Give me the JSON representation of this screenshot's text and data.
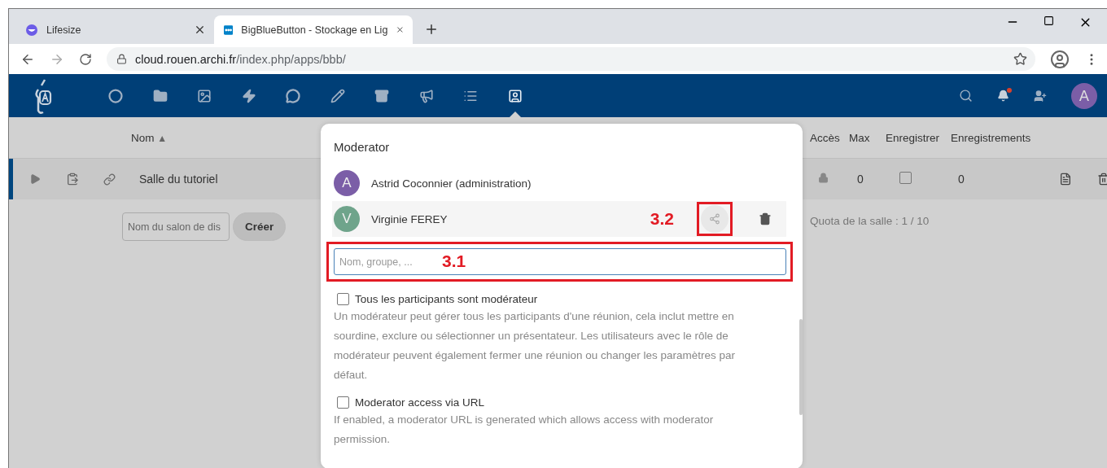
{
  "browser": {
    "tabs": [
      {
        "title": "Lifesize",
        "kind": "lifesize",
        "selected": false
      },
      {
        "title": "BigBlueButton - Stockage en Lig",
        "kind": "bbb",
        "selected": true
      }
    ],
    "url_host": "cloud.rouen.archi.fr",
    "url_path": "/index.php/apps/bbb/"
  },
  "navbar": {
    "apps": [
      {
        "kind": "dashboard",
        "selected": false
      },
      {
        "kind": "files",
        "selected": false
      },
      {
        "kind": "photos",
        "selected": false
      },
      {
        "kind": "activity",
        "selected": false
      },
      {
        "kind": "talk",
        "selected": false
      },
      {
        "kind": "notes",
        "selected": false
      },
      {
        "kind": "deck",
        "selected": false
      },
      {
        "kind": "announce",
        "selected": false
      },
      {
        "kind": "tasks",
        "selected": false
      },
      {
        "kind": "bbb",
        "selected": true
      }
    ],
    "avatar": "A",
    "notification": true
  },
  "table": {
    "columns": [
      {
        "label": "Nom",
        "sort": "▲"
      },
      {
        "label": "Accès"
      },
      {
        "label": "Max"
      },
      {
        "label": "Enregistrer"
      },
      {
        "label": "Enregistrements"
      }
    ],
    "rows": [
      {
        "name": "Salle du tutoriel",
        "active": true,
        "locked": true,
        "max": "0",
        "record": false,
        "recordings": "0"
      }
    ]
  },
  "new_room": {
    "placeholder": "Nom du salon de dis",
    "button": "Créer"
  },
  "quota": "Quota de la salle : 1 / 10",
  "dialog": {
    "title": "Moderator",
    "members": [
      {
        "initial": "A",
        "name": "Astrid Coconnier (administration)",
        "color": "#7b5ea7",
        "highlighted": false
      },
      {
        "initial": "V",
        "name": "Virginie FEREY",
        "color": "#6fa48b",
        "highlighted": true
      }
    ],
    "search_placeholder": "Nom, groupe, ...",
    "options": [
      {
        "label": "Tous les participants sont modérateur",
        "checked": false,
        "description": "Un modérateur peut gérer tous les participants d'une réunion, cela inclut mettre en sourdine, exclure ou sélectionner un présentateur. Les utilisateurs avec le rôle de modérateur peuvent également fermer une réunion ou changer les paramètres par défaut."
      },
      {
        "label": "Moderator access via URL",
        "checked": false,
        "description": "If enabled, a moderator URL is generated which allows access with moderator permission."
      }
    ]
  },
  "annotations": [
    "3.2",
    "3.1"
  ]
}
